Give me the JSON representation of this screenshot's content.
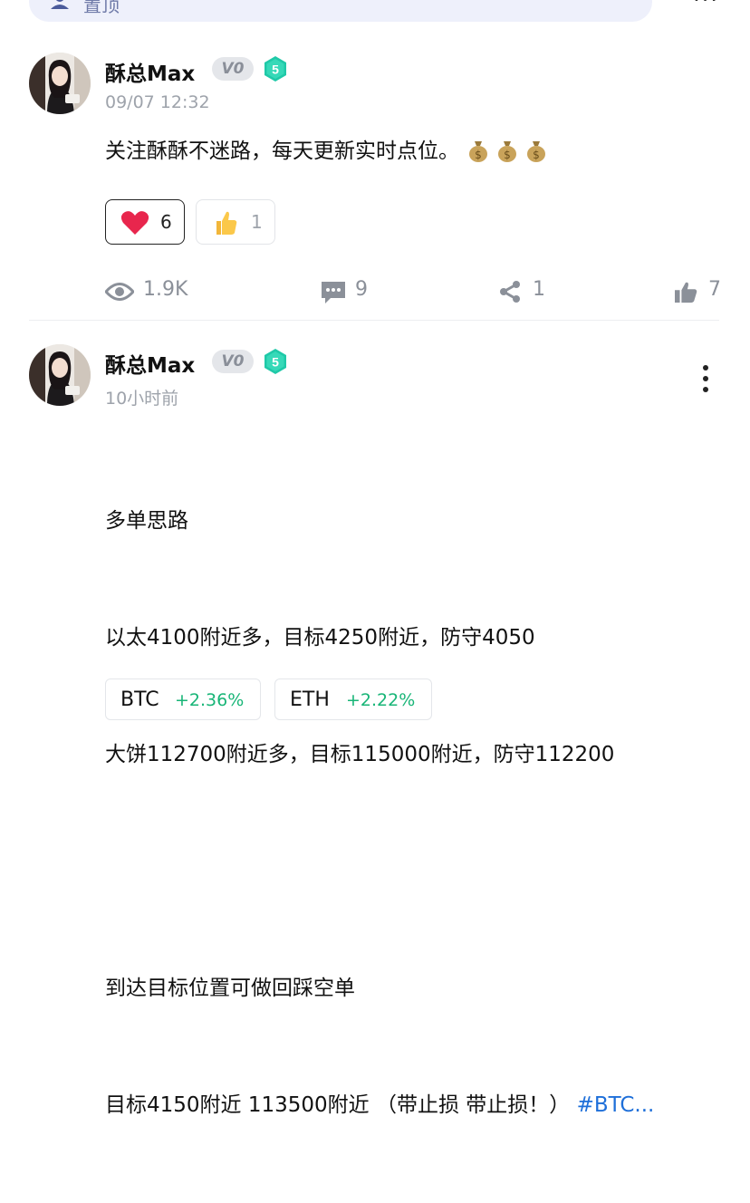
{
  "top_bar": {
    "label": "置顶",
    "more": "···"
  },
  "posts": [
    {
      "author": "酥总Max",
      "vip_badge": "V0",
      "level": "5",
      "time": "09/07 12:32",
      "content": "关注酥酥不迷路，每天更新实时点位。",
      "content_emoji": "money-bag-icon",
      "reactions": [
        {
          "icon": "heart-icon",
          "count": "6",
          "selected": true
        },
        {
          "icon": "thumbs-up-emoji-icon",
          "count": "1",
          "selected": false
        }
      ],
      "stats": {
        "views": "1.9K",
        "comments": "9",
        "shares": "1",
        "likes": "7"
      }
    },
    {
      "author": "酥总Max",
      "vip_badge": "V0",
      "level": "5",
      "time": "10小时前",
      "lines": [
        "多单思路",
        "以太4100附近多，目标4250附近，防守4050",
        "大饼112700附近多，目标115000附近，防守112200",
        "",
        "到达目标位置可做回踩空单",
        "目标4150附近 113500附近 （带止损 带止损！）"
      ],
      "hashtag": "#BTC...",
      "tickers": [
        {
          "symbol": "BTC",
          "change": "+2.36%"
        },
        {
          "symbol": "ETH",
          "change": "+2.22%"
        }
      ]
    }
  ],
  "colors": {
    "positive": "#18b577",
    "link": "#1e6fd9",
    "level_badge": "#1fc9a8"
  }
}
